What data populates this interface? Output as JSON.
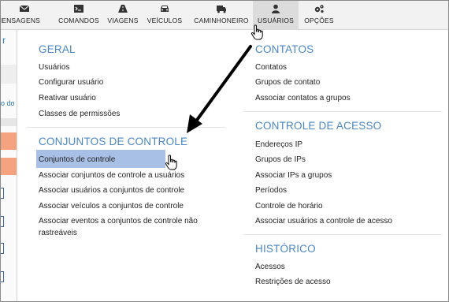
{
  "nav": {
    "items": [
      {
        "label": "MENSAGENS",
        "icon": "envelope-icon"
      },
      {
        "label": "COMANDOS",
        "icon": "terminal-icon"
      },
      {
        "label": "VIAGENS",
        "icon": "road-icon"
      },
      {
        "label": "VEÍCULOS",
        "icon": "car-icon"
      },
      {
        "label": "CAMINHONEIRO",
        "icon": "truck-icon"
      },
      {
        "label": "USUÁRIOS",
        "icon": "user-icon",
        "active": true
      },
      {
        "label": "OPÇÕES",
        "icon": "gears-icon"
      }
    ]
  },
  "behind": {
    "text_partial": "o do"
  },
  "menu": {
    "geral": {
      "title": "GERAL",
      "items": [
        "Usuários",
        "Configurar usuário",
        "Reativar usuário",
        "Classes de permissões"
      ]
    },
    "conjuntos": {
      "title": "CONJUNTOS DE CONTROLE",
      "items": [
        "Conjuntos de controle",
        "Associar conjuntos de controle a usuários",
        "Associar usuários a conjuntos de controle",
        "Associar veículos a conjuntos de controle",
        "Associar eventos a conjuntos de controle não",
        "rastreáveis"
      ]
    },
    "contatos": {
      "title": "CONTATOS",
      "items": [
        "Contatos",
        "Grupos de contato",
        "Associar contatos a grupos"
      ]
    },
    "acesso": {
      "title": "CONTROLE DE ACESSO",
      "items": [
        "Endereços IP",
        "Grupos de IPs",
        "Associar IPs a grupos",
        "Períodos",
        "Controle de horário",
        "Associar usuários a controle de acesso"
      ]
    },
    "historico": {
      "title": "HISTÓRICO",
      "items": [
        "Acessos",
        "Restrições de acesso"
      ]
    }
  },
  "colors": {
    "section_title": "#4a86c5",
    "highlight": "#a8c0e6",
    "nav_bg": "#f2f2f2",
    "nav_active_bg": "#dcdcdc"
  }
}
